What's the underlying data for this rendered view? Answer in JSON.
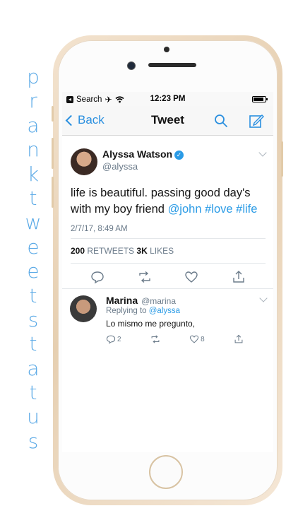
{
  "promo": {
    "letters": [
      "p",
      "r",
      "a",
      "n",
      "k",
      "t",
      "w",
      "e",
      "e",
      "t",
      "s",
      "t",
      "a",
      "t",
      "u",
      "s"
    ]
  },
  "status_bar": {
    "carrier_back_label": "Search",
    "time": "12:23 PM"
  },
  "nav": {
    "back_label": "Back",
    "title": "Tweet"
  },
  "tweet": {
    "author_name": "Alyssa Watson",
    "author_handle": "@alyssa",
    "text_plain": "life is beautiful. passing good day's with my boy friend ",
    "mention": "@john",
    "hashtag_love": "#love",
    "hashtag_life": "#life",
    "timestamp": "2/7/17,  8:49 AM",
    "retweets_count": "200",
    "retweets_label": "RETWEETS",
    "likes_count": "3K",
    "likes_label": "LIKES"
  },
  "reply": {
    "author_name": "Marina",
    "author_handle": "@marina",
    "replying_prefix": "Replying to",
    "replying_to": "@alyssa",
    "text": "Lo mismo me pregunto,",
    "reply_count": "2",
    "like_count": "8"
  },
  "colors": {
    "accent": "#2a9be6",
    "promo_text": "#5aa9e6"
  }
}
